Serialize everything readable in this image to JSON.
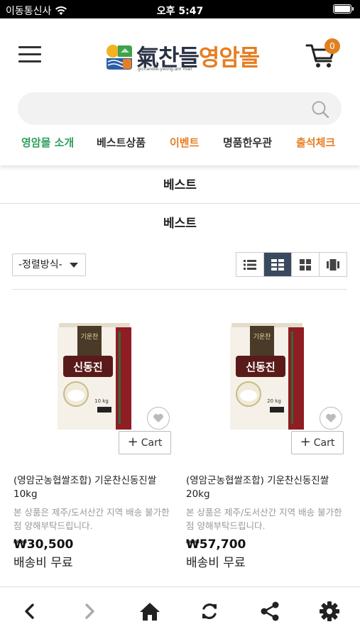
{
  "status_bar": {
    "carrier": "이동통신사",
    "time": "오후 5:47"
  },
  "header": {
    "logo_text_1": "氣찬들",
    "logo_text_2": "영암몰",
    "logo_sub": "gichandle-yeong-am mall",
    "cart_count": "0",
    "search_placeholder": "",
    "nav": [
      {
        "label": "영암몰 소개",
        "color": "#2e9e5b"
      },
      {
        "label": "베스트상품",
        "color": "#333333"
      },
      {
        "label": "이벤트",
        "color": "#e67e22"
      },
      {
        "label": "명품한우관",
        "color": "#333333"
      },
      {
        "label": "출석체크",
        "color": "#e67e22"
      }
    ]
  },
  "page": {
    "breadcrumb_title": "베스트",
    "section_title": "베스트",
    "sort_label": "-정렬방식-",
    "active_view": "grid-2"
  },
  "products": [
    {
      "name": "(영암군농협쌀조합) 기운찬신동진쌀 10kg",
      "desc": "본 상품은 제주/도서산간 지역 배송 불가한 점 양해부탁드립니다.",
      "price": "₩30,500",
      "shipping": "배송비 무료",
      "cart_label": "Cart",
      "bag_label": "신동진",
      "bag_weight": "10 kg"
    },
    {
      "name": "(영암군농협쌀조합) 기운찬신동진쌀 20kg",
      "desc": "본 상품은 제주/도서산간 지역 배송 불가한 점 양해부탁드립니다.",
      "price": "₩57,700",
      "shipping": "배송비 무료",
      "cart_label": "Cart",
      "bag_label": "신동진",
      "bag_weight": "20 kg"
    }
  ],
  "colors": {
    "accent": "#e67e22",
    "active_view_bg": "#3a4a5e",
    "dark_text": "#2a3245"
  }
}
